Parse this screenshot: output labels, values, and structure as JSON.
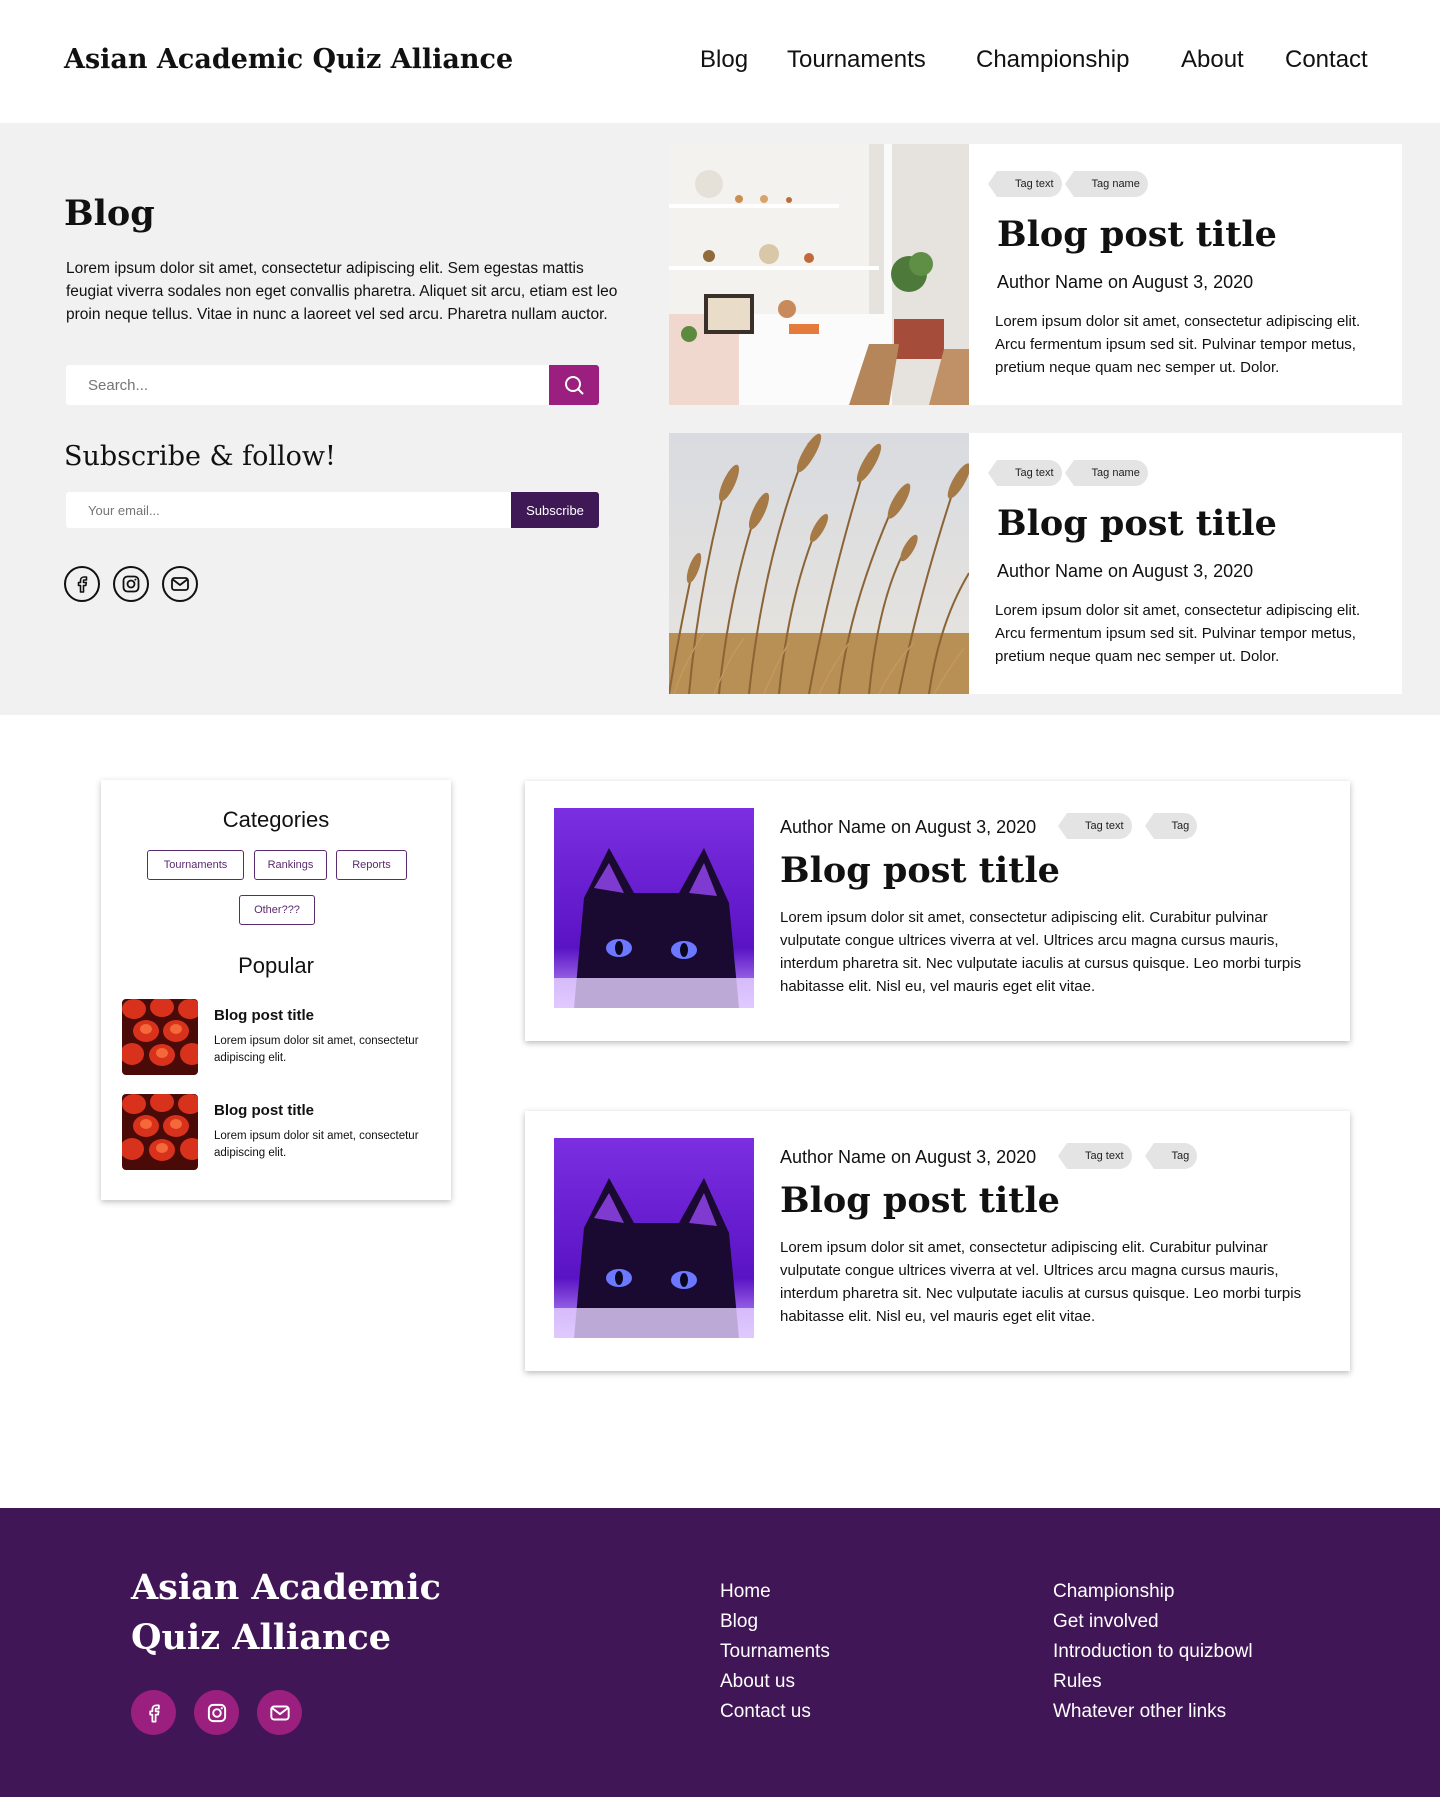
{
  "header": {
    "brand": "Asian Academic Quiz Alliance",
    "nav": [
      "Blog",
      "Tournaments",
      "Championship",
      "About",
      "Contact"
    ]
  },
  "hero": {
    "title": "Blog",
    "description": "Lorem ipsum dolor sit amet, consectetur adipiscing elit. Sem egestas mattis feugiat viverra sodales non eget convallis pharetra. Aliquet sit arcu, etiam est leo proin neque tellus. Vitae in nunc a laoreet vel sed arcu. Pharetra nullam auctor.",
    "search_placeholder": "Search...",
    "subscribe_title": "Subscribe & follow!",
    "email_placeholder": "Your email...",
    "subscribe_label": "Subscribe",
    "social_icons": [
      "facebook-icon",
      "instagram-icon",
      "mail-icon"
    ]
  },
  "featured": [
    {
      "tags": [
        "Tag text",
        "Tag name"
      ],
      "title": "Blog post title",
      "meta": "Author Name on August 3, 2020",
      "excerpt": "Lorem ipsum dolor sit amet, consectetur adipiscing elit. Arcu fermentum ipsum sed sit. Pulvinar tempor metus, pretium neque quam nec semper ut. Dolor."
    },
    {
      "tags": [
        "Tag text",
        "Tag name"
      ],
      "title": "Blog post title",
      "meta": "Author Name on August 3, 2020",
      "excerpt": "Lorem ipsum dolor sit amet, consectetur adipiscing elit. Arcu fermentum ipsum sed sit. Pulvinar tempor metus, pretium neque quam nec semper ut. Dolor."
    }
  ],
  "sidebar": {
    "categories_title": "Categories",
    "categories": [
      "Tournaments",
      "Rankings",
      "Reports",
      "Other???"
    ],
    "popular_title": "Popular",
    "popular": [
      {
        "title": "Blog post title",
        "desc": "Lorem ipsum dolor sit amet, consectetur adipiscing elit."
      },
      {
        "title": "Blog post title",
        "desc": "Lorem ipsum dolor sit amet, consectetur adipiscing elit."
      }
    ]
  },
  "posts": [
    {
      "meta": "Author Name on August 3, 2020",
      "tags": [
        "Tag text",
        "Tag"
      ],
      "title": "Blog post title",
      "excerpt": "Lorem ipsum dolor sit amet, consectetur adipiscing elit. Curabitur pulvinar vulputate congue ultrices viverra at vel. Ultrices arcu magna cursus mauris, interdum pharetra sit. Nec vulputate iaculis at cursus quisque. Leo morbi turpis habitasse elit. Nisl eu, vel mauris eget elit vitae."
    },
    {
      "meta": "Author Name on August 3, 2020",
      "tags": [
        "Tag text",
        "Tag"
      ],
      "title": "Blog post title",
      "excerpt": "Lorem ipsum dolor sit amet, consectetur adipiscing elit. Curabitur pulvinar vulputate congue ultrices viverra at vel. Ultrices arcu magna cursus mauris, interdum pharetra sit. Nec vulputate iaculis at cursus quisque. Leo morbi turpis habitasse elit. Nisl eu, vel mauris eget elit vitae."
    }
  ],
  "footer": {
    "brand_line1": "Asian Academic",
    "brand_line2": "Quiz Alliance",
    "links_col1": [
      "Home",
      "Blog",
      "Tournaments",
      "About us",
      "Contact us"
    ],
    "links_col2": [
      "Championship",
      "Get involved",
      "Introduction to quizbowl",
      "Rules",
      "Whatever other links"
    ],
    "social_icons": [
      "facebook-icon",
      "instagram-icon",
      "mail-icon"
    ]
  },
  "colors": {
    "accent": "#9b1f7e",
    "dark_purple": "#411656",
    "subscribe_bg": "#3f1856",
    "hero_bg": "#f1f1f1"
  }
}
